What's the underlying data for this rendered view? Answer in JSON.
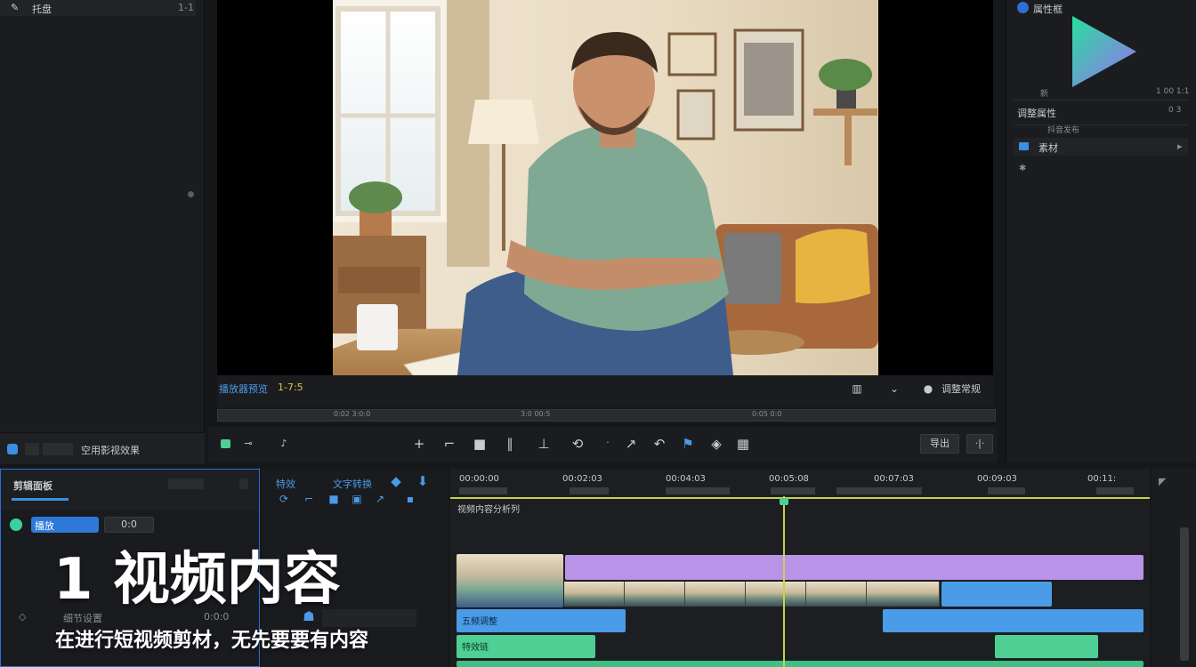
{
  "left": {
    "top_label": "托盘",
    "top_right": "1-1",
    "footer_label": "空用影视效果"
  },
  "viewer": {
    "left_label": "播放器预览",
    "badge": "1-7:5",
    "right_label": "调整常规",
    "scrub_ticks": [
      "0:02 3:0:0",
      "3:0 00:5",
      "0:05 0:0"
    ],
    "toolbar_right_button": "导出"
  },
  "right": {
    "header": "属性框",
    "row1_left": "新",
    "row1_right": "1 00 1:1",
    "section": "调整属性",
    "section_right": "0 3",
    "sub_row": "抖音发布",
    "sub_row2": "素材",
    "play_logo_color": "#2bd9a0"
  },
  "bottom_left": {
    "title": "剪辑面板",
    "chip": "播放",
    "chip_btn": "0:0",
    "row_label": "细节设置",
    "row_value": "0:0:0"
  },
  "bottom_mid": {
    "tab1": "特效",
    "tab2": "文字转换"
  },
  "timeline": {
    "ruler": [
      "00:00:00",
      "00:02:03",
      "00:04:03",
      "00:05:08",
      "00:07:03",
      "00:09:03",
      "00:11:"
    ],
    "track_label": "视频内容分析列",
    "audio_label1": "五频调整",
    "audio_label2": "特效链",
    "colors": {
      "playhead": "#c8d24a",
      "purple": "#b993e8",
      "blue": "#4a9be8",
      "green": "#4fcf94"
    }
  },
  "caption": {
    "title": "1 视频内容",
    "subtitle": "在进行短视频剪材，无先要要有内容"
  }
}
